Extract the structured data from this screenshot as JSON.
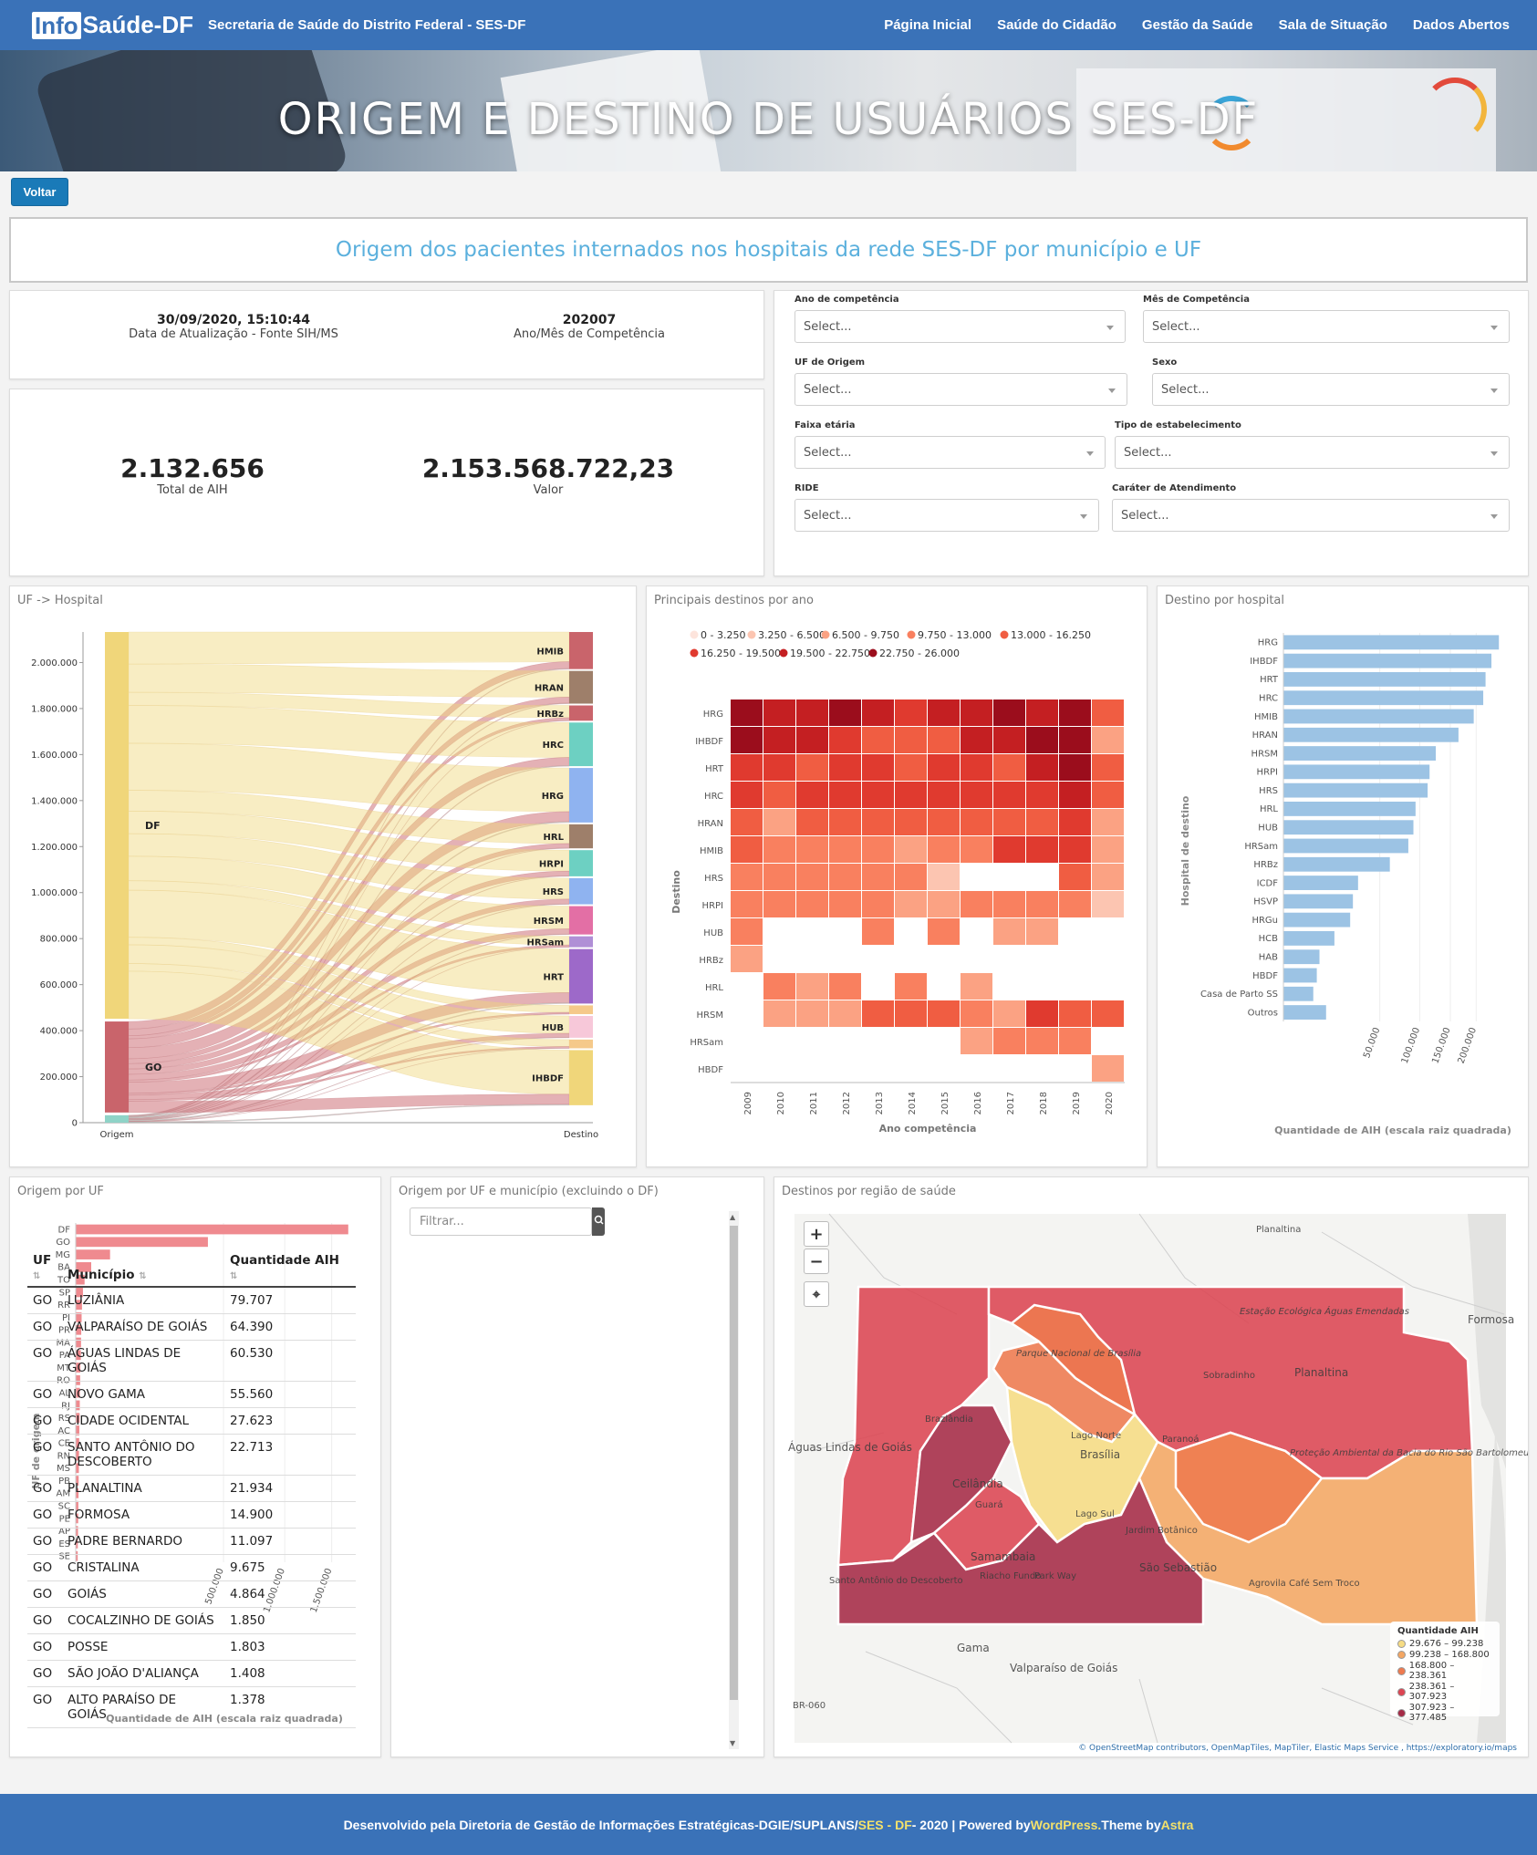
{
  "header": {
    "logo_box": "Info",
    "logo_rest": "Saúde-DF",
    "subtitle": "Secretaria de Saúde do Distrito Federal - SES-DF",
    "nav": [
      "Página Inicial",
      "Saúde do Cidadão",
      "Gestão da Saúde",
      "Sala de Situação",
      "Dados Abertos"
    ]
  },
  "hero_title": "ORIGEM E DESTINO DE USUÁRIOS SES-DF",
  "back_label": "Voltar",
  "banner_text": "Origem dos pacientes internados nos hospitais da rede SES-DF por município e UF",
  "info": {
    "update_value": "30/09/2020, 15:10:44",
    "update_label": "Data de Atualização - Fonte SIH/MS",
    "comp_value": "202007",
    "comp_label": "Ano/Mês de Competência",
    "total_value": "2.132.656",
    "total_label": "Total de AIH",
    "valor_value": "2.153.568.722,23",
    "valor_label": "Valor"
  },
  "filters": [
    {
      "label": "Ano de competência",
      "placeholder": "Select..."
    },
    {
      "label": "Mês de Competência",
      "placeholder": "Select..."
    },
    {
      "label": "UF de Origem",
      "placeholder": "Select..."
    },
    {
      "label": "Sexo",
      "placeholder": "Select..."
    },
    {
      "label": "Faixa etária",
      "placeholder": "Select..."
    },
    {
      "label": "Tipo de estabelecimento",
      "placeholder": "Select..."
    },
    {
      "label": "RIDE",
      "placeholder": "Select..."
    },
    {
      "label": "Caráter de Atendimento",
      "placeholder": "Select..."
    }
  ],
  "panels": {
    "sankey": "UF -> Hospital",
    "heatmap": "Principais destinos por ano",
    "hospital": "Destino por hospital",
    "origem_uf": "Origem por UF",
    "municipio": "Origem por UF e município (excluindo o DF)",
    "regiao": "Destinos por região de saúde"
  },
  "chart_data": [
    {
      "type": "sankey",
      "y_ticks": [
        "0",
        "200.000",
        "400.000",
        "600.000",
        "800.000",
        "1.000.000",
        "1.200.000",
        "1.400.000",
        "1.600.000",
        "1.800.000",
        "2.000.000"
      ],
      "ylim": [
        0,
        2132656
      ],
      "x_ticks": [
        "Origem",
        "Destino"
      ],
      "sources": [
        {
          "name": "DF",
          "value": 1700000,
          "color": "#f0d67a"
        },
        {
          "name": "GO",
          "value": 400000,
          "color": "#c9646b"
        },
        {
          "name": "",
          "value": 32656,
          "color": "#8fd3c7"
        }
      ],
      "targets": [
        {
          "name": "HMIB",
          "value": 170000,
          "color": "#c9646b"
        },
        {
          "name": "HRAN",
          "value": 150000,
          "color": "#9e7f6a"
        },
        {
          "name": "HRBz",
          "value": 70000,
          "color": "#c9646b"
        },
        {
          "name": "HRC",
          "value": 200000,
          "color": "#6dd0c2"
        },
        {
          "name": "HRG",
          "value": 250000,
          "color": "#8fb3f0"
        },
        {
          "name": "HRL",
          "value": 110000,
          "color": "#9e7f6a"
        },
        {
          "name": "HRPI",
          "value": 120000,
          "color": "#6dd0c2"
        },
        {
          "name": "HRS",
          "value": 120000,
          "color": "#8fb3f0"
        },
        {
          "name": "HRSM",
          "value": 130000,
          "color": "#e36fa5"
        },
        {
          "name": "HRSam",
          "value": 50000,
          "color": "#b08fd6"
        },
        {
          "name": "HRT",
          "value": 250000,
          "color": "#9d69c9"
        },
        {
          "name": "",
          "value": 40000,
          "color": "#f5c98a"
        },
        {
          "name": "HUB",
          "value": 100000,
          "color": "#f7c8d9"
        },
        {
          "name": "",
          "value": 40000,
          "color": "#f5c98a"
        },
        {
          "name": "IHBDF",
          "value": 252656,
          "color": "#f0d67a"
        }
      ]
    },
    {
      "type": "heatmap",
      "legend": [
        "0 - 3.250",
        "3.250 - 6.500",
        "6.500 - 9.750",
        "9.750 - 13.000",
        "13.000 - 16.250",
        "16.250 - 19.500",
        "19.500 - 22.750",
        "22.750 - 26.000"
      ],
      "colors": [
        "#fde4dc",
        "#fcc5b1",
        "#fba283",
        "#f9805f",
        "#f05d42",
        "#e03a2f",
        "#c41f22",
        "#9b0d1c"
      ],
      "xlabel": "Ano competência",
      "ylabel": "Destino",
      "x": [
        "2009",
        "2010",
        "2011",
        "2012",
        "2013",
        "2014",
        "2015",
        "2016",
        "2017",
        "2018",
        "2019",
        "2020"
      ],
      "y": [
        "HRG",
        "IHBDF",
        "HRT",
        "HRC",
        "HRAN",
        "HMIB",
        "HRS",
        "HRPI",
        "HUB",
        "HRBz",
        "HRL",
        "HRSM",
        "HRSam",
        "HBDF"
      ],
      "bins": [
        [
          7,
          6,
          6,
          7,
          6,
          5,
          6,
          6,
          7,
          6,
          7,
          4
        ],
        [
          7,
          6,
          6,
          5,
          4,
          4,
          4,
          6,
          6,
          7,
          7,
          2
        ],
        [
          5,
          5,
          4,
          5,
          5,
          4,
          5,
          5,
          4,
          6,
          7,
          4
        ],
        [
          5,
          4,
          5,
          5,
          5,
          5,
          5,
          5,
          5,
          5,
          6,
          4
        ],
        [
          4,
          2,
          4,
          4,
          4,
          4,
          4,
          4,
          4,
          4,
          5,
          2
        ],
        [
          4,
          3,
          3,
          3,
          3,
          2,
          3,
          3,
          5,
          5,
          5,
          2
        ],
        [
          3,
          3,
          3,
          3,
          3,
          3,
          1,
          -1,
          -1,
          -1,
          4,
          2
        ],
        [
          3,
          3,
          3,
          3,
          3,
          2,
          2,
          3,
          3,
          3,
          3,
          1
        ],
        [
          3,
          -1,
          -1,
          -1,
          3,
          -1,
          3,
          -1,
          2,
          2,
          -1,
          -1
        ],
        [
          2,
          -1,
          -1,
          -1,
          -1,
          -1,
          -1,
          -1,
          -1,
          -1,
          -1,
          -1
        ],
        [
          -1,
          3,
          2,
          3,
          -1,
          3,
          -1,
          2,
          -1,
          -1,
          -1,
          -1
        ],
        [
          -1,
          2,
          2,
          2,
          4,
          4,
          4,
          3,
          2,
          5,
          4,
          4
        ],
        [
          -1,
          -1,
          -1,
          -1,
          -1,
          -1,
          -1,
          2,
          3,
          3,
          3,
          -1
        ],
        [
          -1,
          -1,
          -1,
          -1,
          -1,
          -1,
          -1,
          -1,
          -1,
          -1,
          -1,
          2
        ]
      ]
    },
    {
      "type": "bar",
      "orientation": "horizontal",
      "scale": "sqrt",
      "xlabel": "Quantidade de AIH (escala raiz quadrada)",
      "ylabel": "Hospital de destino",
      "x_ticks": [
        50000,
        100000,
        150000,
        200000
      ],
      "x_tick_labels": [
        "50.000",
        "100.000",
        "150.000",
        "200.000"
      ],
      "xlim": [
        0,
        280000
      ],
      "categories": [
        "HRG",
        "IHBDF",
        "HRT",
        "HRC",
        "HMIB",
        "HRAN",
        "HRSM",
        "HRPI",
        "HRS",
        "HRL",
        "HUB",
        "HRSam",
        "HRBz",
        "ICDF",
        "HSVP",
        "HRGu",
        "HCB",
        "HAB",
        "HBDF",
        "Casa de Parto SS",
        "Outros"
      ],
      "values": [
        250000,
        233000,
        220000,
        215000,
        195000,
        165000,
        125000,
        115000,
        112000,
        94000,
        91000,
        84000,
        61000,
        30000,
        26000,
        24000,
        14000,
        7000,
        6000,
        4800,
        9800
      ],
      "color": "#9cc3e4"
    },
    {
      "type": "bar",
      "orientation": "horizontal",
      "scale": "sqrt",
      "xlabel": "Quantidade de AIH (escala raiz quadrada)",
      "ylabel": "UF de origem",
      "x_ticks": [
        500000,
        1000000,
        1500000
      ],
      "x_tick_labels": [
        "500.000",
        "1.000.000",
        "1.500.000"
      ],
      "xlim": [
        0,
        1950000
      ],
      "categories": [
        "DF",
        "GO",
        "MG",
        "BA",
        "TO",
        "SP",
        "RR",
        "PI",
        "PR",
        "MA",
        "PA",
        "MT",
        "RO",
        "AL",
        "RJ",
        "RS",
        "AC",
        "CE",
        "RN",
        "MS",
        "PB",
        "AM",
        "SC",
        "PE",
        "AP",
        "ES",
        "SE"
      ],
      "values": [
        1700000,
        400000,
        27000,
        5500,
        1800,
        1200,
        900,
        800,
        700,
        650,
        600,
        500,
        450,
        400,
        380,
        350,
        300,
        280,
        250,
        230,
        200,
        180,
        160,
        140,
        120,
        100,
        90
      ],
      "color": "#ef8a8f"
    }
  ],
  "table": {
    "filter_placeholder": "Filtrar...",
    "headers": {
      "uf": "UF",
      "municipio": "Município",
      "qtd": "Quantidade AIH"
    },
    "rows": [
      {
        "uf": "GO",
        "municipio": "LUZIÂNIA",
        "qtd": "79.707"
      },
      {
        "uf": "GO",
        "municipio": "VALPARAÍSO DE GOIÁS",
        "qtd": "64.390"
      },
      {
        "uf": "GO",
        "municipio": "ÁGUAS LINDAS DE GOIÁS",
        "qtd": "60.530"
      },
      {
        "uf": "GO",
        "municipio": "NOVO GAMA",
        "qtd": "55.560"
      },
      {
        "uf": "GO",
        "municipio": "CIDADE OCIDENTAL",
        "qtd": "27.623"
      },
      {
        "uf": "GO",
        "municipio": "SANTO ANTÔNIO DO DESCOBERTO",
        "qtd": "22.713"
      },
      {
        "uf": "GO",
        "municipio": "PLANALTINA",
        "qtd": "21.934"
      },
      {
        "uf": "GO",
        "municipio": "FORMOSA",
        "qtd": "14.900"
      },
      {
        "uf": "GO",
        "municipio": "PADRE BERNARDO",
        "qtd": "11.097"
      },
      {
        "uf": "GO",
        "municipio": "CRISTALINA",
        "qtd": "9.675"
      },
      {
        "uf": "GO",
        "municipio": "GOIÁS",
        "qtd": "4.864"
      },
      {
        "uf": "GO",
        "municipio": "COCALZINHO DE GOIÁS",
        "qtd": "1.850"
      },
      {
        "uf": "GO",
        "municipio": "POSSE",
        "qtd": "1.803"
      },
      {
        "uf": "GO",
        "municipio": "SÃO JOÃO D'ALIANÇA",
        "qtd": "1.408"
      },
      {
        "uf": "GO",
        "municipio": "ALTO PARAÍSO DE GOIÁS",
        "qtd": "1.378"
      }
    ]
  },
  "map": {
    "legend_title": "Quantidade AIH",
    "legend": [
      {
        "label": "29.676 – 99.238",
        "color": "#f6dc83"
      },
      {
        "label": "99.238 – 168.800",
        "color": "#f4a763"
      },
      {
        "label": "168.800 – 238.361",
        "color": "#ee7a4f"
      },
      {
        "label": "238.361 – 307.923",
        "color": "#dc4552"
      },
      {
        "label": "307.923 – 377.485",
        "color": "#a52a46"
      }
    ],
    "place_labels": [
      "Planaltina",
      "Formosa",
      "Planaltina",
      "Sobradinho",
      "Parque Nacional de Brasília",
      "Brazlândia",
      "Águas Lindas de Goiás",
      "Lago Norte",
      "Brasília",
      "Paranoá",
      "Ceilândia",
      "Guará",
      "Lago Sul",
      "Jardim Botânico",
      "Samambaia",
      "Riacho Fundo",
      "Park Way",
      "São Sebastião",
      "Santo Antônio do Descoberto",
      "Gama",
      "Valparaíso de Goiás",
      "Agrovila Café Sem Troco",
      "Estação Ecológica Águas Emendadas",
      "Proteção Ambiental da Bacia do Rio São Bartolomeu",
      "BR-060"
    ],
    "attribution": "© OpenStreetMap contributors, OpenMapTiles, MapTiler, Elastic Maps Service , https://exploratory.io/maps",
    "zoom_in": "+",
    "zoom_out": "−",
    "reset": "⌖"
  },
  "footer": {
    "text1": "Desenvolvido pela Diretoria de Gestão de Informações Estratégicas-DGIE/SUPLANS/ ",
    "hl1": "SES - DF",
    "text2": " - 2020 | Powered by ",
    "hl2": "WordPress.",
    "text3": " Theme by ",
    "hl3": "Astra"
  },
  "colors": {
    "brand": "#3a72b8",
    "button": "#1a7ab8",
    "banner_text": "#5bb0dd"
  }
}
